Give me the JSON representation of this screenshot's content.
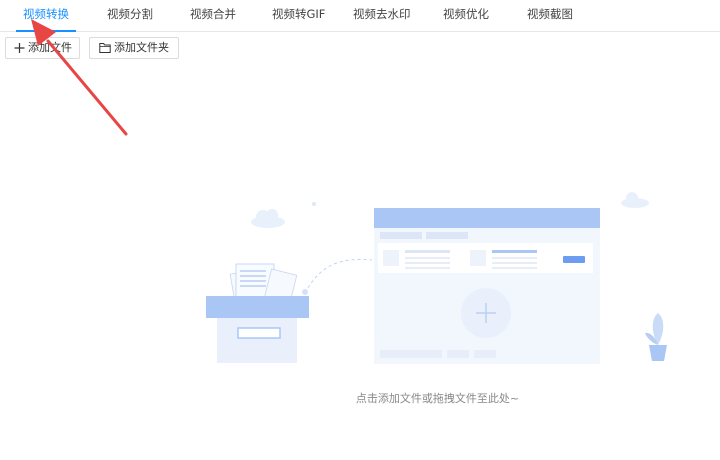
{
  "tabs": [
    {
      "label": "视频转换",
      "active": true
    },
    {
      "label": "视频分割",
      "active": false
    },
    {
      "label": "视频合并",
      "active": false
    },
    {
      "label": "视频转GIF",
      "active": false
    },
    {
      "label": "视频去水印",
      "active": false
    },
    {
      "label": "视频优化",
      "active": false
    },
    {
      "label": "视频截图",
      "active": false
    }
  ],
  "toolbar": {
    "add_file_label": "添加文件",
    "add_folder_label": "添加文件夹"
  },
  "dropzone": {
    "hint": "点击添加文件或拖拽文件至此处~"
  },
  "colors": {
    "accent": "#1890ff",
    "arrow": "#e84545",
    "illustration_blue": "#a9c6f5"
  },
  "icons": {
    "add_file": "plus-icon",
    "add_folder": "folder-icon"
  }
}
